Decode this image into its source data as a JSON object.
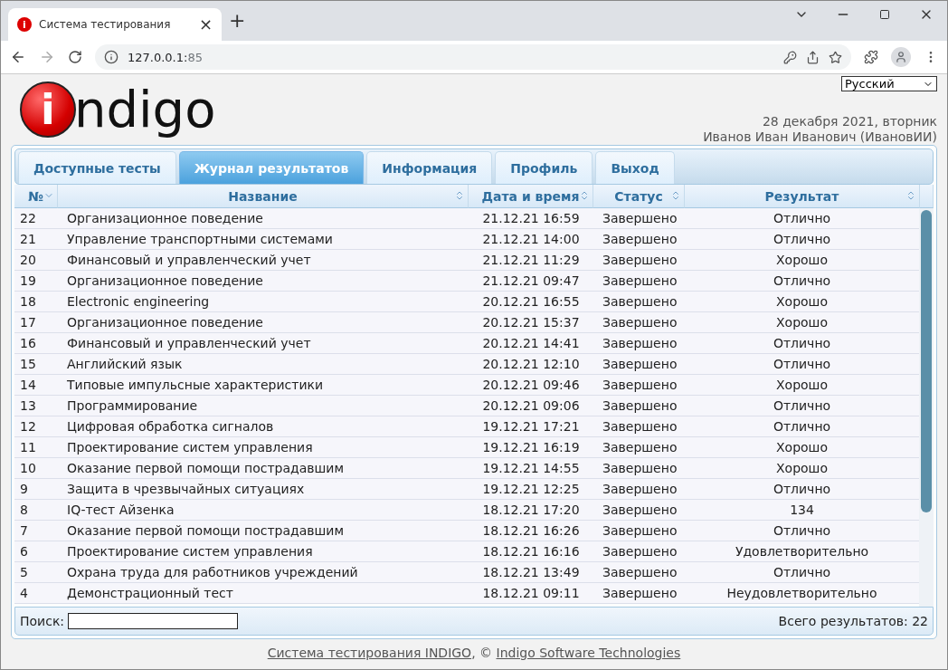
{
  "browser": {
    "favicon": "i",
    "tab_title": "Система тестирования",
    "tab_close": "×",
    "new_tab": "+",
    "address_host": "127.0.0.1:",
    "address_port": "85"
  },
  "language": "Русский",
  "logo": {
    "mark": "i",
    "text": "ndigo"
  },
  "date": "28 декабря 2021, вторник",
  "user": "Иванов Иван Иванович (ИвановИИ)",
  "tabs": [
    {
      "label": "Доступные тесты",
      "selected": false
    },
    {
      "label": "Журнал результатов",
      "selected": true
    },
    {
      "label": "Информация",
      "selected": false
    },
    {
      "label": "Профиль",
      "selected": false
    },
    {
      "label": "Выход",
      "selected": false
    }
  ],
  "table": {
    "columns": [
      {
        "label": "№",
        "sorted": true
      },
      {
        "label": "Название",
        "sorted": false
      },
      {
        "label": "Дата и время",
        "sorted": false
      },
      {
        "label": "Статус",
        "sorted": false
      },
      {
        "label": "Результат",
        "sorted": false
      }
    ],
    "rows": [
      [
        "22",
        "Организационное поведение",
        "21.12.21 16:59",
        "Завершено",
        "Отлично"
      ],
      [
        "21",
        "Управление транспортными системами",
        "21.12.21 14:00",
        "Завершено",
        "Отлично"
      ],
      [
        "20",
        "Финансовый и управленческий учет",
        "21.12.21 11:29",
        "Завершено",
        "Хорошо"
      ],
      [
        "19",
        "Организационное поведение",
        "21.12.21 09:47",
        "Завершено",
        "Отлично"
      ],
      [
        "18",
        "Electronic engineering",
        "20.12.21 16:55",
        "Завершено",
        "Хорошо"
      ],
      [
        "17",
        "Организационное поведение",
        "20.12.21 15:37",
        "Завершено",
        "Хорошо"
      ],
      [
        "16",
        "Финансовый и управленческий учет",
        "20.12.21 14:41",
        "Завершено",
        "Отлично"
      ],
      [
        "15",
        "Английский язык",
        "20.12.21 12:10",
        "Завершено",
        "Отлично"
      ],
      [
        "14",
        "Типовые импульсные характеристики",
        "20.12.21 09:46",
        "Завершено",
        "Хорошо"
      ],
      [
        "13",
        "Программирование",
        "20.12.21 09:06",
        "Завершено",
        "Отлично"
      ],
      [
        "12",
        "Цифровая обработка сигналов",
        "19.12.21 17:21",
        "Завершено",
        "Отлично"
      ],
      [
        "11",
        "Проектирование систем управления",
        "19.12.21 16:19",
        "Завершено",
        "Хорошо"
      ],
      [
        "10",
        "Оказание первой помощи пострадавшим",
        "19.12.21 14:55",
        "Завершено",
        "Хорошо"
      ],
      [
        "9",
        "Защита в чрезвычайных ситуациях",
        "19.12.21 12:25",
        "Завершено",
        "Отлично"
      ],
      [
        "8",
        "IQ-тест Айзенка",
        "18.12.21 17:20",
        "Завершено",
        "134"
      ],
      [
        "7",
        "Оказание первой помощи пострадавшим",
        "18.12.21 16:26",
        "Завершено",
        "Отлично"
      ],
      [
        "6",
        "Проектирование систем управления",
        "18.12.21 16:16",
        "Завершено",
        "Удовлетворительно"
      ],
      [
        "5",
        "Охрана труда для работников учреждений",
        "18.12.21 13:49",
        "Завершено",
        "Отлично"
      ],
      [
        "4",
        "Демонстрационный тест",
        "18.12.21 09:11",
        "Завершено",
        "Неудовлетворительно"
      ]
    ]
  },
  "search": {
    "label": "Поиск:"
  },
  "total": "Всего результатов: 22",
  "footer": {
    "link1": "Система тестирования INDIGO",
    "sep": ", ©",
    "link2": "Indigo Software Technologies"
  }
}
